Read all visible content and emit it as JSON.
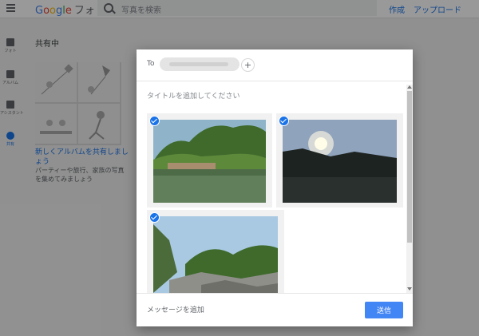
{
  "app": {
    "logo_google": [
      "G",
      "o",
      "o",
      "g",
      "l",
      "e"
    ],
    "logo_product": "フォト",
    "search_placeholder": "写真を検索",
    "create_label": "作成",
    "upload_label": "アップロード"
  },
  "nav": {
    "items": [
      {
        "label": "フォト",
        "icon": "photo-icon"
      },
      {
        "label": "アルバム",
        "icon": "album-icon"
      },
      {
        "label": "アシスタント",
        "icon": "assistant-icon"
      },
      {
        "label": "共有",
        "icon": "people-icon",
        "active": true
      }
    ]
  },
  "shared": {
    "section_title": "共有中",
    "album_title": "新しくアルバムを共有しましょう",
    "album_description": "パーティーや旅行、家族の写真を集めてみましょう"
  },
  "dialog": {
    "to_label": "To",
    "add_recipient": "+",
    "title_placeholder": "タイトルを追加してください",
    "message_placeholder": "メッセージを追加",
    "send_label": "送信",
    "photos": [
      {
        "subject": "river-forest",
        "selected": true
      },
      {
        "subject": "sunset-river",
        "selected": true
      },
      {
        "subject": "rocky-cliffs",
        "selected": true
      }
    ]
  },
  "colors": {
    "accent": "#1a73e8",
    "send_button": "#4285f4",
    "overlay": "rgba(0,0,0,0.40)"
  }
}
